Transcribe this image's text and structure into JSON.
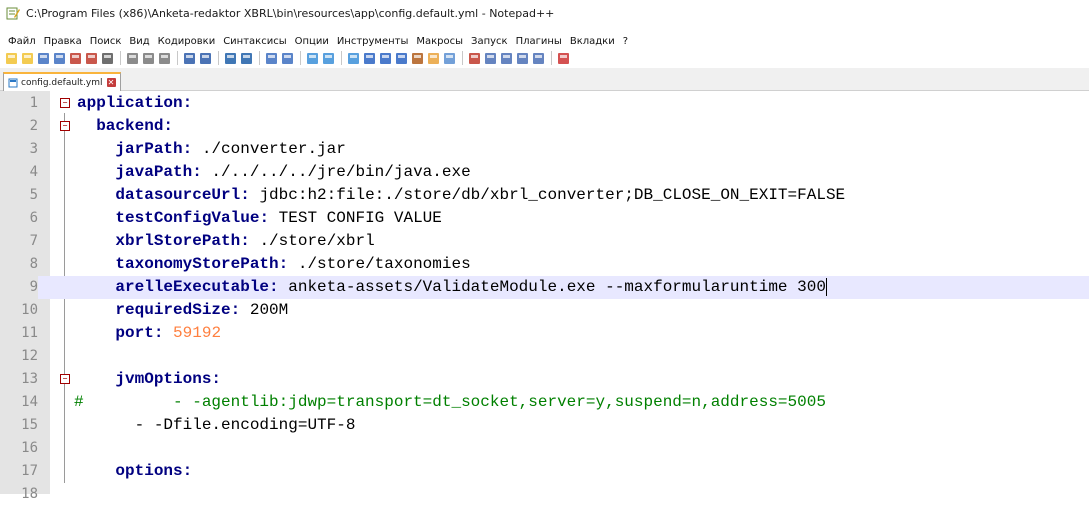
{
  "window": {
    "title": "C:\\Program Files (x86)\\Anketa-redaktor XBRL\\bin\\resources\\app\\config.default.yml - Notepad++"
  },
  "menu": [
    "Файл",
    "Правка",
    "Поиск",
    "Вид",
    "Кодировки",
    "Синтаксисы",
    "Опции",
    "Инструменты",
    "Макросы",
    "Запуск",
    "Плагины",
    "Вкладки",
    "?"
  ],
  "toolbar_icons": [
    "new-file-icon",
    "open-file-icon",
    "save-icon",
    "save-all-icon",
    "close-icon",
    "close-all-icon",
    "print-icon",
    "cut-icon",
    "copy-icon",
    "paste-icon",
    "undo-icon",
    "redo-icon",
    "find-icon",
    "replace-icon",
    "zoom-in-icon",
    "zoom-out-icon",
    "sync-vertical-icon",
    "sync-horizontal-icon",
    "word-wrap-icon",
    "show-all-chars-icon",
    "indent-guide-icon",
    "function-list-icon",
    "doc-map-icon",
    "folder-workspace-icon",
    "monitor-icon",
    "record-macro-icon",
    "stop-macro-icon",
    "play-macro-icon",
    "run-macro-multiple-icon",
    "save-macro-icon",
    "spell-check-icon"
  ],
  "tab": {
    "label": "config.default.yml"
  },
  "editor": {
    "current_line": 9,
    "lines": [
      {
        "n": "1",
        "indent": "",
        "key": "application",
        "sep": ":",
        "value": "",
        "fold": "top"
      },
      {
        "n": "2",
        "indent": "  ",
        "key": "backend",
        "sep": ":",
        "value": "",
        "fold": "open"
      },
      {
        "n": "3",
        "indent": "    ",
        "key": "jarPath",
        "sep": ":",
        "value": " ./converter.jar"
      },
      {
        "n": "4",
        "indent": "    ",
        "key": "javaPath",
        "sep": ":",
        "value": " ./../../../jre/bin/java.exe"
      },
      {
        "n": "5",
        "indent": "    ",
        "key": "datasourceUrl",
        "sep": ":",
        "value": " jdbc:h2:file:./store/db/xbrl_converter;DB_CLOSE_ON_EXIT=FALSE"
      },
      {
        "n": "6",
        "indent": "    ",
        "key": "testConfigValue",
        "sep": ":",
        "value": " TEST CONFIG VALUE"
      },
      {
        "n": "7",
        "indent": "    ",
        "key": "xbrlStorePath",
        "sep": ":",
        "value": " ./store/xbrl"
      },
      {
        "n": "8",
        "indent": "    ",
        "key": "taxonomyStorePath",
        "sep": ":",
        "value": " ./store/taxonomies"
      },
      {
        "n": "9",
        "indent": "    ",
        "key": "arelleExecutable",
        "sep": ":",
        "value": " anketa-assets/ValidateModule.exe --maxformularuntime 300"
      },
      {
        "n": "10",
        "indent": "    ",
        "key": "requiredSize",
        "sep": ":",
        "value": " 200M"
      },
      {
        "n": "11",
        "indent": "    ",
        "key": "port",
        "sep": ":",
        "value": " ",
        "num": "59192"
      },
      {
        "n": "12",
        "indent": "",
        "key": "",
        "sep": "",
        "value": ""
      },
      {
        "n": "13",
        "indent": "    ",
        "key": "jvmOptions",
        "sep": ":",
        "value": "",
        "fold": "open"
      },
      {
        "n": "14",
        "indent": "",
        "key": "",
        "sep": "",
        "value": "",
        "comment": "#",
        "comment_body": "          - -agentlib:jdwp=transport=dt_socket,server=y,suspend=n,address=5005"
      },
      {
        "n": "15",
        "indent": "      ",
        "key": "",
        "sep": "",
        "value": "- -Dfile.encoding=UTF-8"
      },
      {
        "n": "16",
        "indent": "",
        "key": "",
        "sep": "",
        "value": ""
      },
      {
        "n": "17",
        "indent": "    ",
        "key": "options",
        "sep": ":",
        "value": ""
      },
      {
        "n": "18",
        "indent": "",
        "key": "",
        "sep": "",
        "value": ""
      }
    ]
  },
  "colors": {
    "keyword": "#000080",
    "number": "#ff8040",
    "comment": "#008000",
    "current_line": "#e8e8ff",
    "gutter": "#e4e4e4",
    "tab_accent": "#f9b43c"
  }
}
